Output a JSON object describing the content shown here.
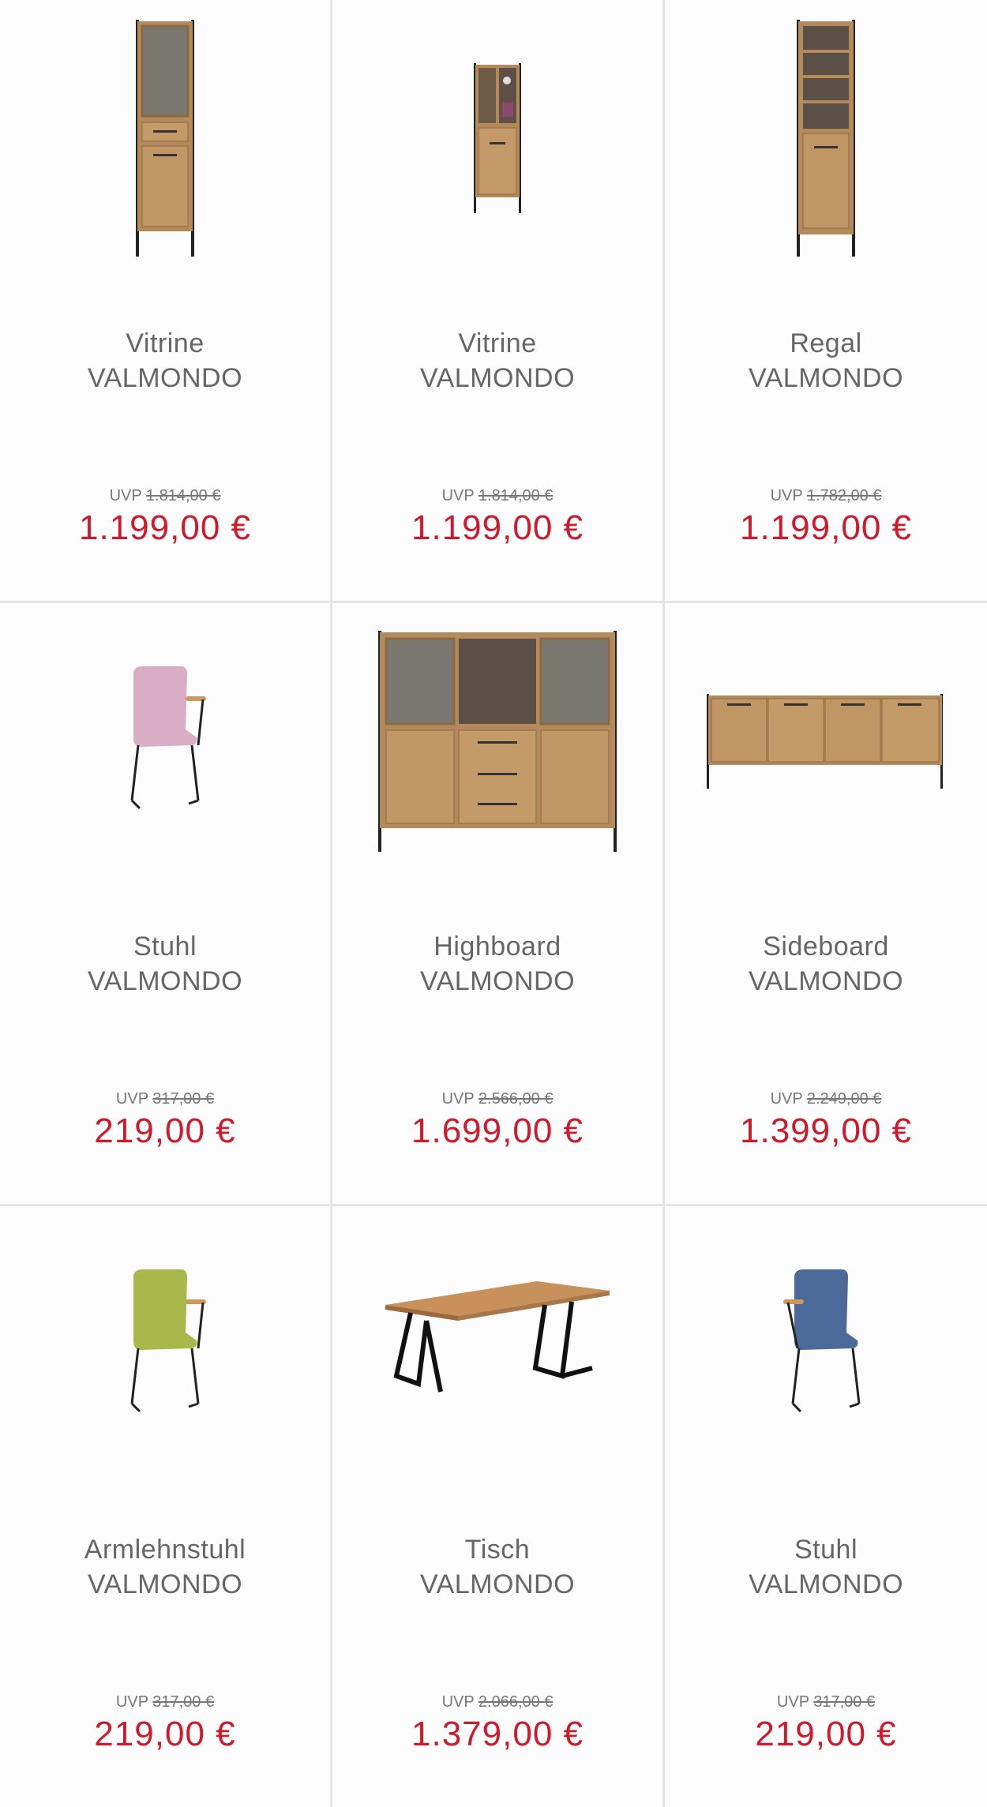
{
  "products": [
    {
      "name": "Vitrine",
      "brand": "VALMONDO",
      "uvp_label": "UVP",
      "uvp": "1.814,00 €",
      "price": "1.199,00 €",
      "image": "vitrine-tall-icon"
    },
    {
      "name": "Vitrine",
      "brand": "VALMONDO",
      "uvp_label": "UVP",
      "uvp": "1.814,00 €",
      "price": "1.199,00 €",
      "image": "vitrine-small-icon"
    },
    {
      "name": "Regal",
      "brand": "VALMONDO",
      "uvp_label": "UVP",
      "uvp": "1.782,00 €",
      "price": "1.199,00 €",
      "image": "regal-icon"
    },
    {
      "name": "Stuhl",
      "brand": "VALMONDO",
      "uvp_label": "UVP",
      "uvp": "317,00 €",
      "price": "219,00 €",
      "image": "chair-pink-icon"
    },
    {
      "name": "Highboard",
      "brand": "VALMONDO",
      "uvp_label": "UVP",
      "uvp": "2.566,00 €",
      "price": "1.699,00 €",
      "image": "highboard-icon"
    },
    {
      "name": "Sideboard",
      "brand": "VALMONDO",
      "uvp_label": "UVP",
      "uvp": "2.249,00 €",
      "price": "1.399,00 €",
      "image": "sideboard-icon"
    },
    {
      "name": "Armlehnstuhl",
      "brand": "VALMONDO",
      "uvp_label": "UVP",
      "uvp": "317,00 €",
      "price": "219,00 €",
      "image": "chair-green-icon"
    },
    {
      "name": "Tisch",
      "brand": "VALMONDO",
      "uvp_label": "UVP",
      "uvp": "2.066,00 €",
      "price": "1.379,00 €",
      "image": "table-icon"
    },
    {
      "name": "Stuhl",
      "brand": "VALMONDO",
      "uvp_label": "UVP",
      "uvp": "317,00 €",
      "price": "219,00 €",
      "image": "chair-blue-icon"
    }
  ],
  "colors": {
    "price": "#d01a2c",
    "text": "#666666",
    "wood": "#b48a5a",
    "metal": "#222222"
  }
}
